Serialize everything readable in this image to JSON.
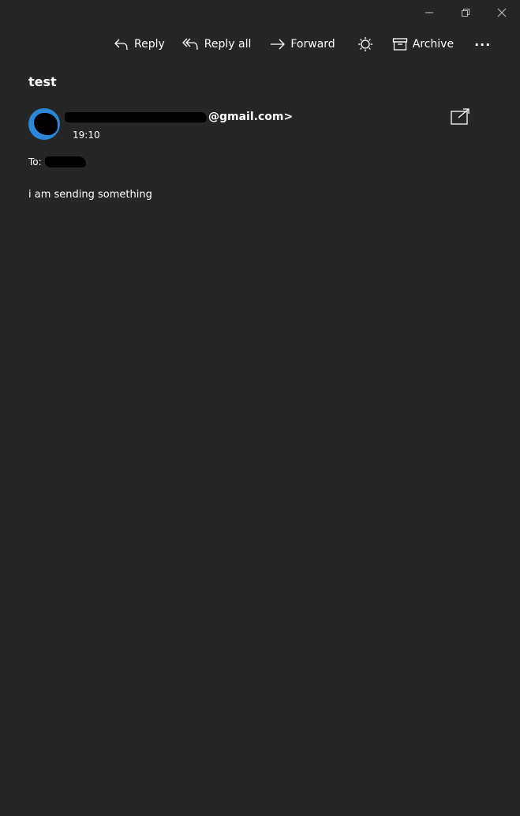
{
  "window": {
    "minimize_label": "Minimize",
    "restore_label": "Restore",
    "close_label": "Close"
  },
  "toolbar": {
    "reply": "Reply",
    "reply_all": "Reply all",
    "forward": "Forward",
    "archive": "Archive",
    "more": "···"
  },
  "message": {
    "subject": "test",
    "sender_suffix": "@gmail.com>",
    "time": "19:10",
    "to_label": "To:",
    "body": "i am sending something"
  },
  "colors": {
    "background": "#262626",
    "avatar": "#2b88d8",
    "text": "#ffffff"
  },
  "icons": [
    "reply-icon",
    "reply-all-icon",
    "forward-icon",
    "brightness-icon",
    "archive-icon",
    "more-icon",
    "popout-icon",
    "minimize-icon",
    "restore-icon",
    "close-icon"
  ]
}
